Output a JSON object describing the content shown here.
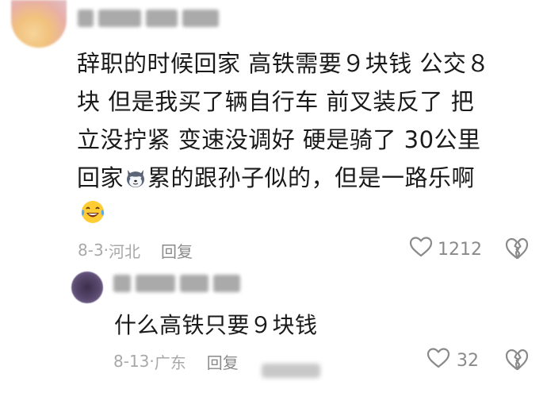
{
  "comment": {
    "lines": [
      "辞职的时候回家 高铁需要９块钱 公交８",
      "块  但是我买了辆自行车  前叉装反了  把",
      "立没拧紧 变速没调好 硬是骑了 30公里"
    ],
    "last_line_start": "回家",
    "last_line_end": "累的跟孙子似的，但是一路乐啊",
    "inline_emoji": "husky-emoji",
    "trailing_emoji": "laughing-tears-emoji",
    "date": "8-3",
    "separator": "·",
    "location": "河北",
    "reply_label": "回复",
    "like_count": "1212"
  },
  "reply": {
    "text": "什么高铁只要９块钱",
    "date": "8-13",
    "separator": "·",
    "location": "广东",
    "reply_label": "回复",
    "like_count": "32"
  },
  "colors": {
    "text": "#1a1a1a",
    "meta": "#a8a8a8",
    "icon": "#8a8a8a"
  }
}
